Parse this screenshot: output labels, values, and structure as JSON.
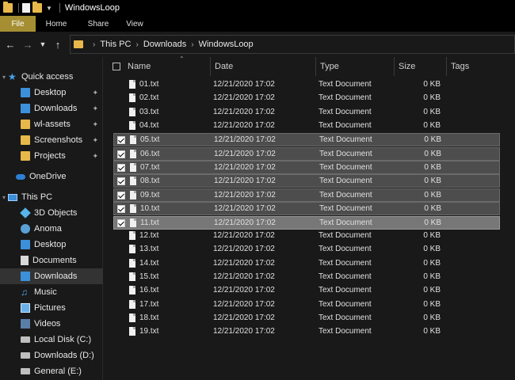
{
  "window": {
    "title": "WindowsLoop"
  },
  "ribbon": {
    "tabs": [
      "File",
      "Home",
      "Share",
      "View"
    ]
  },
  "address": {
    "crumbs": [
      "This PC",
      "Downloads",
      "WindowsLoop"
    ]
  },
  "sidebar": {
    "items": [
      {
        "label": "Quick access",
        "icon": "star-icon"
      },
      {
        "label": "Desktop",
        "icon": "desktop-icon",
        "pinned": true
      },
      {
        "label": "Downloads",
        "icon": "download-icon",
        "pinned": true
      },
      {
        "label": "wl-assets",
        "icon": "folder-icon",
        "pinned": true
      },
      {
        "label": "Screenshots",
        "icon": "folder-icon",
        "pinned": true
      },
      {
        "label": "Projects",
        "icon": "folder-icon",
        "pinned": true
      },
      {
        "label": "OneDrive",
        "icon": "cloud-icon"
      },
      {
        "label": "This PC",
        "icon": "pc-icon"
      },
      {
        "label": "3D Objects",
        "icon": "cube-icon"
      },
      {
        "label": "Anoma",
        "icon": "user-icon"
      },
      {
        "label": "Desktop",
        "icon": "desktop-icon"
      },
      {
        "label": "Documents",
        "icon": "documents-icon"
      },
      {
        "label": "Downloads",
        "icon": "download-icon",
        "selected": true
      },
      {
        "label": "Music",
        "icon": "music-icon"
      },
      {
        "label": "Pictures",
        "icon": "pictures-icon"
      },
      {
        "label": "Videos",
        "icon": "videos-icon"
      },
      {
        "label": "Local Disk (C:)",
        "icon": "disk-icon"
      },
      {
        "label": "Downloads (D:)",
        "icon": "disk-icon"
      },
      {
        "label": "General (E:)",
        "icon": "disk-icon"
      }
    ]
  },
  "columns": {
    "name": "Name",
    "date": "Date",
    "type": "Type",
    "size": "Size",
    "tags": "Tags"
  },
  "files": [
    {
      "name": "01.txt",
      "date": "12/21/2020 17:02",
      "type": "Text Document",
      "size": "0 KB",
      "state": "none"
    },
    {
      "name": "02.txt",
      "date": "12/21/2020 17:02",
      "type": "Text Document",
      "size": "0 KB",
      "state": "none"
    },
    {
      "name": "03.txt",
      "date": "12/21/2020 17:02",
      "type": "Text Document",
      "size": "0 KB",
      "state": "none"
    },
    {
      "name": "04.txt",
      "date": "12/21/2020 17:02",
      "type": "Text Document",
      "size": "0 KB",
      "state": "none"
    },
    {
      "name": "05.txt",
      "date": "12/21/2020 17:02",
      "type": "Text Document",
      "size": "0 KB",
      "state": "selected"
    },
    {
      "name": "06.txt",
      "date": "12/21/2020 17:02",
      "type": "Text Document",
      "size": "0 KB",
      "state": "selected"
    },
    {
      "name": "07.txt",
      "date": "12/21/2020 17:02",
      "type": "Text Document",
      "size": "0 KB",
      "state": "selected"
    },
    {
      "name": "08.txt",
      "date": "12/21/2020 17:02",
      "type": "Text Document",
      "size": "0 KB",
      "state": "selected"
    },
    {
      "name": "09.txt",
      "date": "12/21/2020 17:02",
      "type": "Text Document",
      "size": "0 KB",
      "state": "selected"
    },
    {
      "name": "10.txt",
      "date": "12/21/2020 17:02",
      "type": "Text Document",
      "size": "0 KB",
      "state": "selected"
    },
    {
      "name": "11.txt",
      "date": "12/21/2020 17:02",
      "type": "Text Document",
      "size": "0 KB",
      "state": "focused"
    },
    {
      "name": "12.txt",
      "date": "12/21/2020 17:02",
      "type": "Text Document",
      "size": "0 KB",
      "state": "none"
    },
    {
      "name": "13.txt",
      "date": "12/21/2020 17:02",
      "type": "Text Document",
      "size": "0 KB",
      "state": "none"
    },
    {
      "name": "14.txt",
      "date": "12/21/2020 17:02",
      "type": "Text Document",
      "size": "0 KB",
      "state": "none"
    },
    {
      "name": "15.txt",
      "date": "12/21/2020 17:02",
      "type": "Text Document",
      "size": "0 KB",
      "state": "none"
    },
    {
      "name": "16.txt",
      "date": "12/21/2020 17:02",
      "type": "Text Document",
      "size": "0 KB",
      "state": "none"
    },
    {
      "name": "17.txt",
      "date": "12/21/2020 17:02",
      "type": "Text Document",
      "size": "0 KB",
      "state": "none"
    },
    {
      "name": "18.txt",
      "date": "12/21/2020 17:02",
      "type": "Text Document",
      "size": "0 KB",
      "state": "none"
    },
    {
      "name": "19.txt",
      "date": "12/21/2020 17:02",
      "type": "Text Document",
      "size": "0 KB",
      "state": "none"
    }
  ]
}
